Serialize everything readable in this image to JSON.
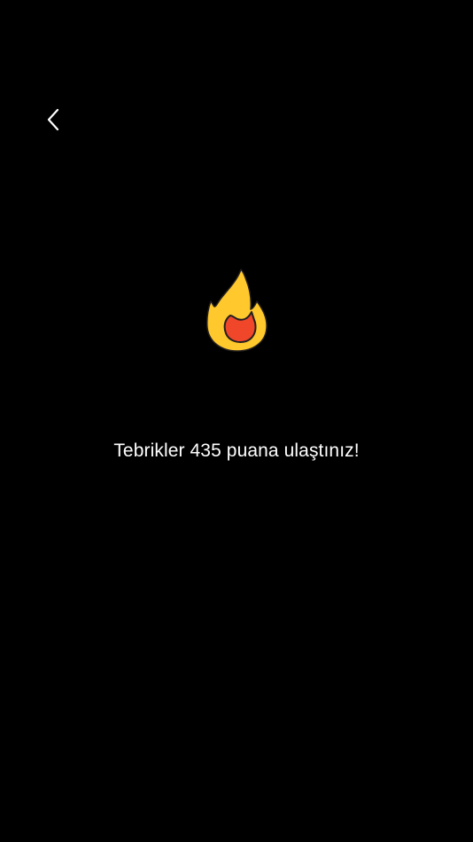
{
  "nav": {
    "back_icon": "chevron-left-icon"
  },
  "hero": {
    "icon": "fire-icon",
    "colors": {
      "flame_outer": "#FFC82C",
      "flame_inner": "#F0462A",
      "outline": "#231F20"
    }
  },
  "message": {
    "text": "Tebrikler 435 puana ulaştınız!"
  },
  "theme": {
    "background": "#000000",
    "text": "#FFFFFF"
  }
}
